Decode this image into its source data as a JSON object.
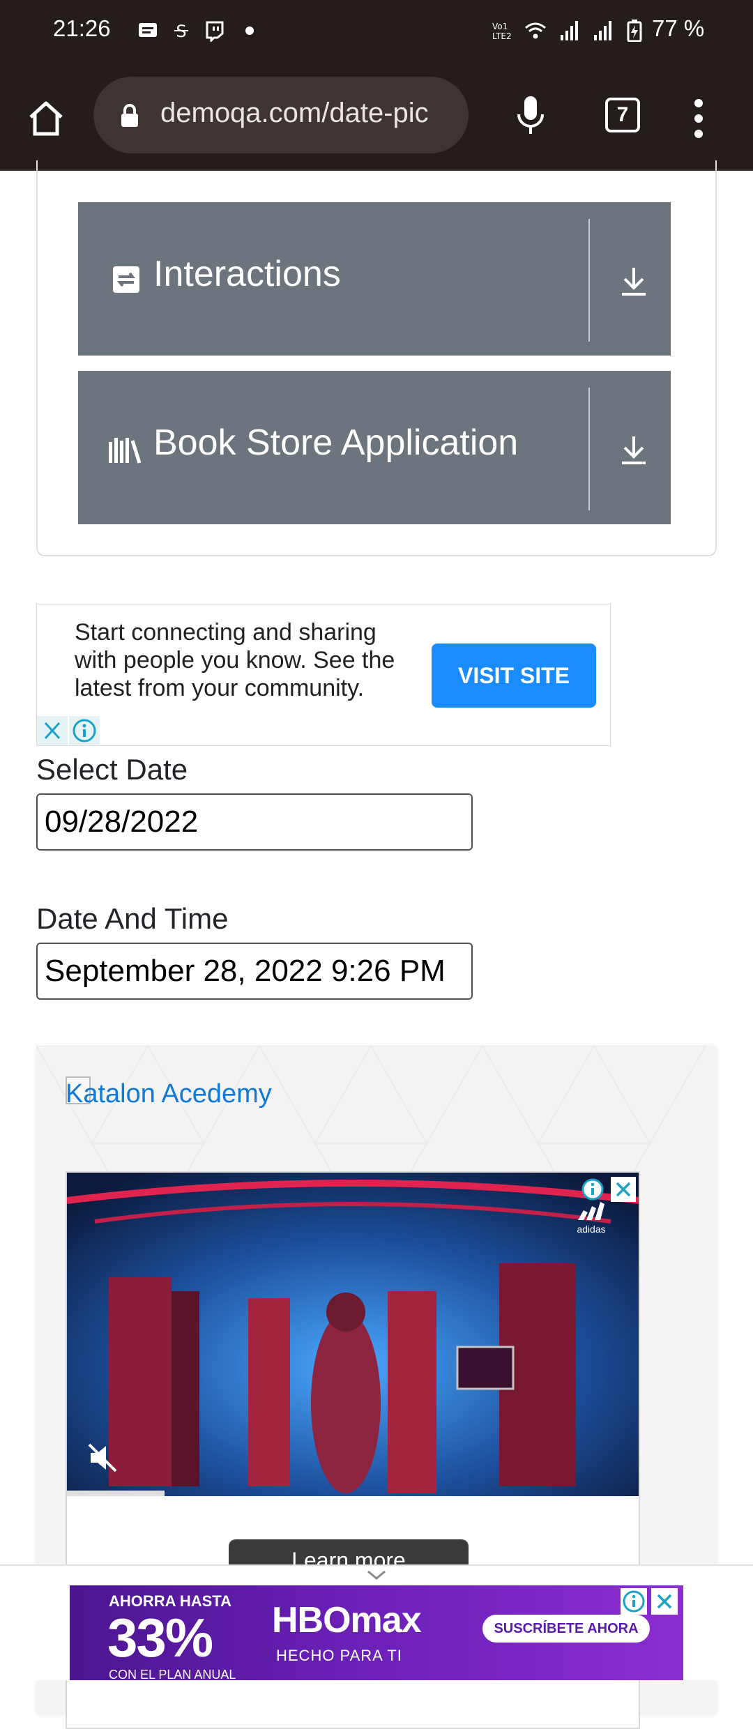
{
  "status_bar": {
    "time": "21:26",
    "battery": "77 %",
    "icons": [
      "message-icon",
      "sim-icon",
      "twitch-icon",
      "dot-icon",
      "volte-icon",
      "wifi-icon",
      "signal-icon",
      "signal-icon",
      "battery-charging-icon"
    ]
  },
  "browser": {
    "url": "demoqa.com/date-pic",
    "tab_count": "7"
  },
  "groups": [
    {
      "title": "Interactions",
      "icon": "interactions-icon"
    },
    {
      "title": "Book Store Application",
      "icon": "books-icon"
    }
  ],
  "ad1": {
    "text": "Start connecting and sharing with people you know. See the latest from your community.",
    "button": "VISIT SITE"
  },
  "form": {
    "select_date_label": "Select Date",
    "select_date_value": "09/28/2022",
    "datetime_label": "Date And Time",
    "datetime_value": "September 28, 2022 9:26 PM"
  },
  "katalon": {
    "link_text": "Katalon Acedemy",
    "video_brand": "adidas",
    "learn_more": "Learn more"
  },
  "bottom_ad": {
    "top_line": "AHORRA HASTA",
    "percent": "33%",
    "sub_line": "CON EL PLAN ANUAL",
    "brand": "HBOmax",
    "tagline": "HECHO PARA TI",
    "cta": "SUSCRÍBETE AHORA"
  },
  "colors": {
    "chrome_bg": "#241d1b",
    "group_header": "#6c757d",
    "ad_button": "#1a8cff",
    "link": "#0e79d8",
    "banner_purple": "#6a1fb5"
  }
}
